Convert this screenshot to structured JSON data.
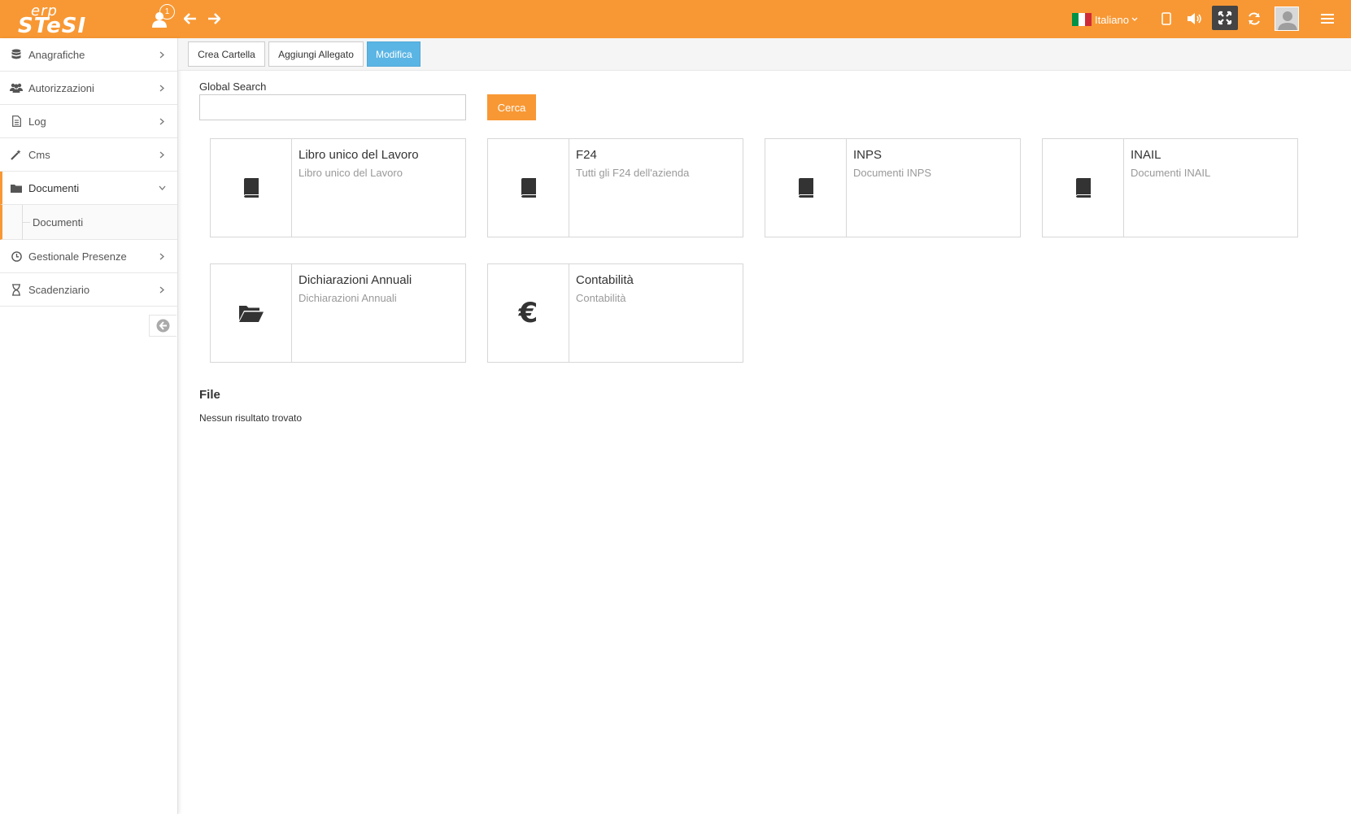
{
  "topbar": {
    "logo_line1": "erp",
    "logo_line2": "STeSI",
    "notification_count": "1",
    "language": "Italiano",
    "brand_color": "#f89834"
  },
  "sidebar": {
    "items": [
      {
        "label": "Anagrafiche",
        "icon": "database-icon"
      },
      {
        "label": "Autorizzazioni",
        "icon": "users-icon"
      },
      {
        "label": "Log",
        "icon": "file-text-icon"
      },
      {
        "label": "Cms",
        "icon": "magic-wand-icon"
      },
      {
        "label": "Documenti",
        "icon": "folder-icon",
        "expanded": true
      },
      {
        "label": "Gestionale Presenze",
        "icon": "clock-icon"
      },
      {
        "label": "Scadenziario",
        "icon": "hourglass-icon"
      }
    ],
    "subitem": "Documenti"
  },
  "toolbar": {
    "crea_cartella": "Crea Cartella",
    "aggiungi_allegato": "Aggiungi Allegato",
    "modifica": "Modifica"
  },
  "search": {
    "label": "Global Search",
    "value": "",
    "placeholder": "",
    "button": "Cerca"
  },
  "cards": [
    {
      "title": "Libro unico del Lavoro",
      "subtitle": "Libro unico del Lavoro",
      "icon": "book-icon"
    },
    {
      "title": "F24",
      "subtitle": "Tutti gli F24 dell'azienda",
      "icon": "book-icon"
    },
    {
      "title": "INPS",
      "subtitle": "Documenti INPS",
      "icon": "book-icon"
    },
    {
      "title": "INAIL",
      "subtitle": "Documenti INAIL",
      "icon": "book-icon"
    },
    {
      "title": "Dichiarazioni Annuali",
      "subtitle": "Dichiarazioni Annuali",
      "icon": "folder-open-icon"
    },
    {
      "title": "Contabilità",
      "subtitle": "Contabilità",
      "icon": "euro-icon",
      "symbol": "€"
    }
  ],
  "files": {
    "title": "File",
    "empty": "Nessun risultato trovato"
  }
}
